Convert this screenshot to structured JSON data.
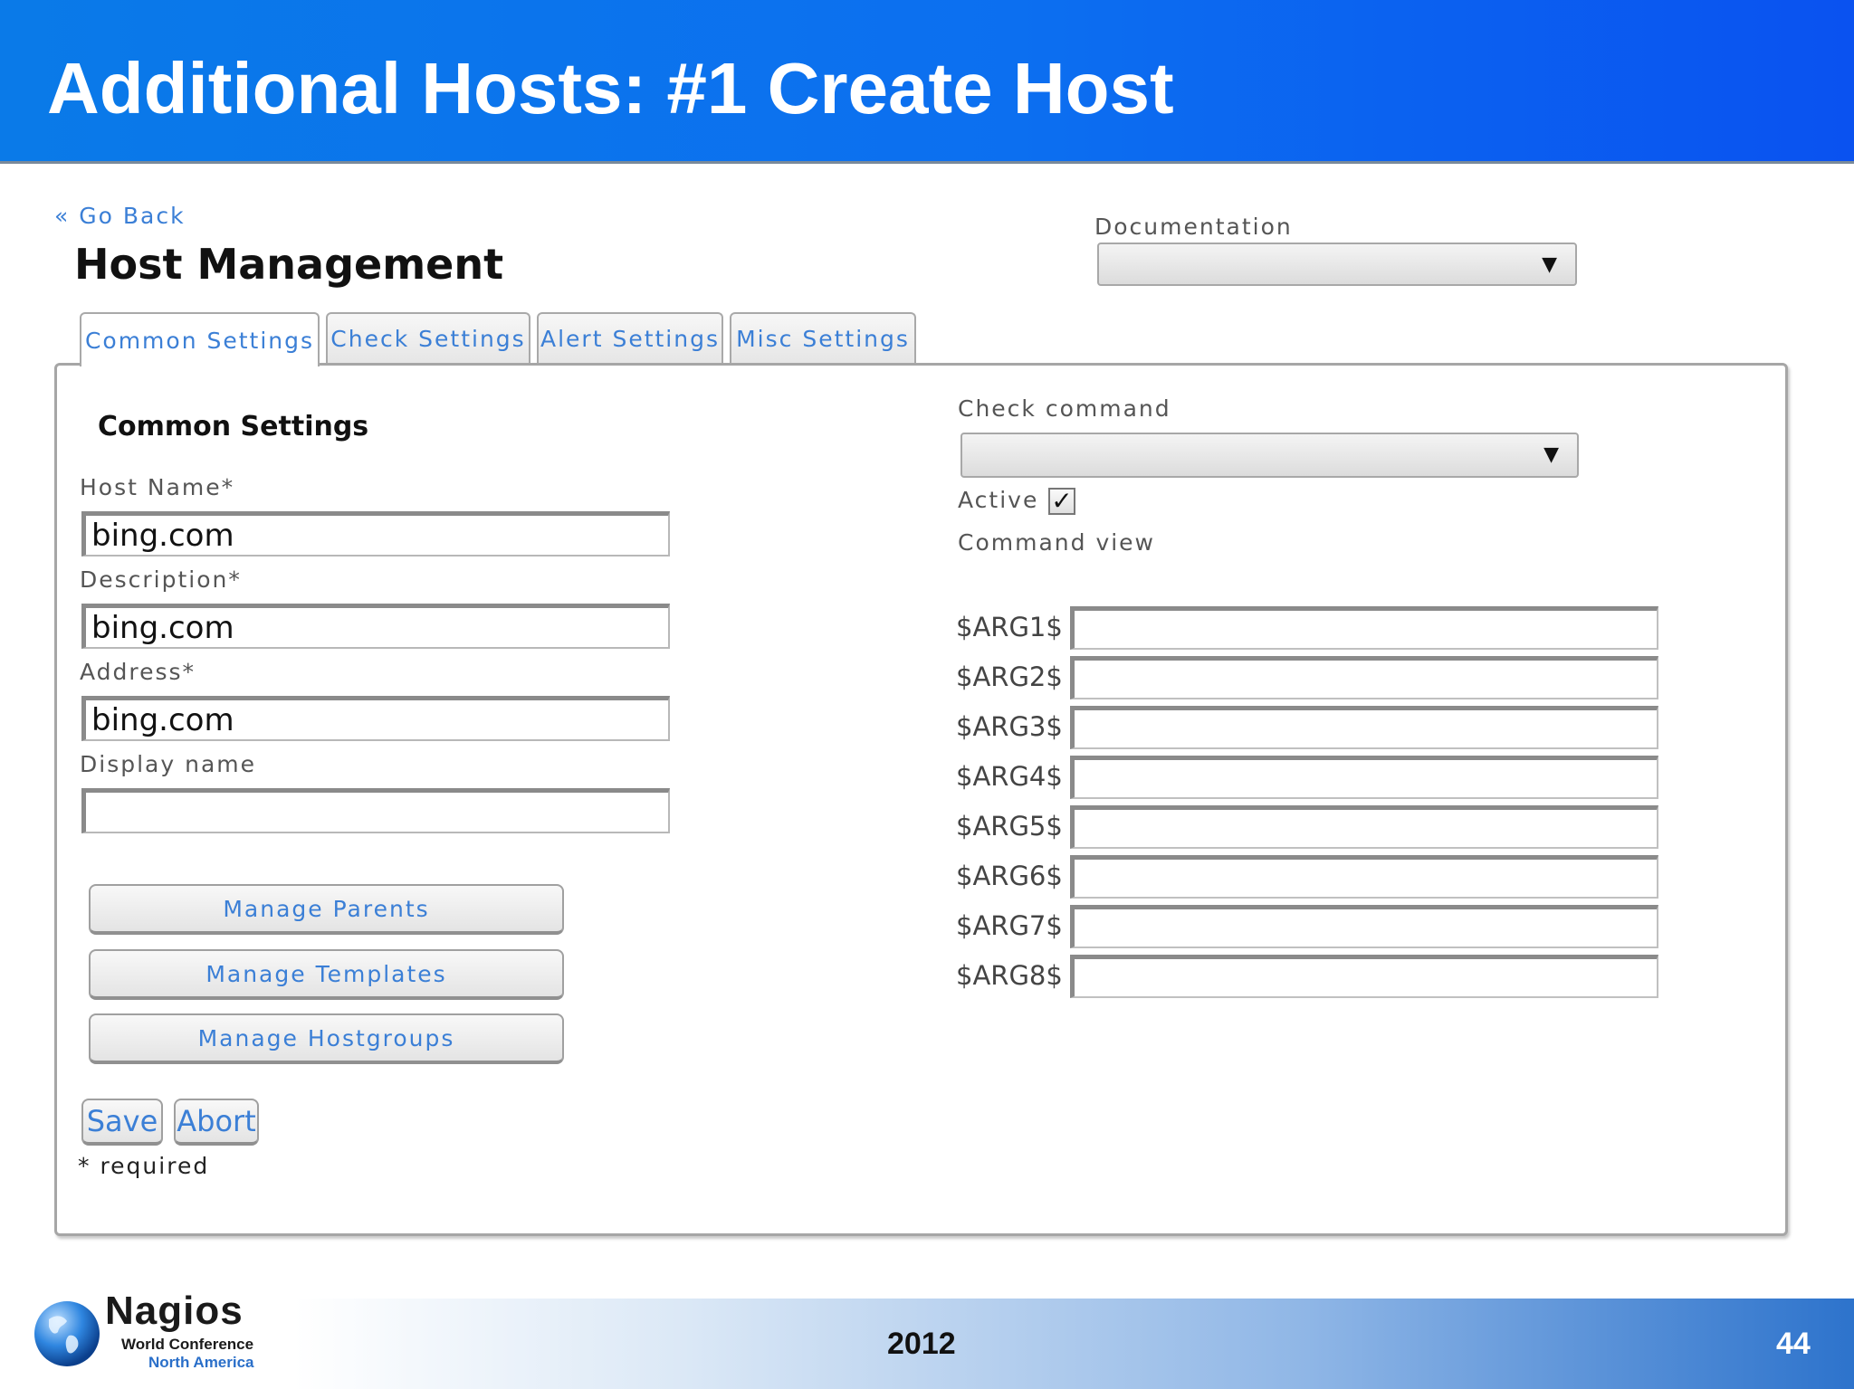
{
  "slide": {
    "title": "Additional Hosts: #1 Create Host"
  },
  "page": {
    "go_back": "« Go Back",
    "heading": "Host Management",
    "documentation": {
      "label": "Documentation",
      "value": ""
    }
  },
  "tabs": [
    {
      "label": "Common Settings",
      "active": true
    },
    {
      "label": "Check Settings",
      "active": false
    },
    {
      "label": "Alert Settings",
      "active": false
    },
    {
      "label": "Misc Settings",
      "active": false
    }
  ],
  "common": {
    "section_title": "Common Settings",
    "fields": [
      {
        "label": "Host Name*",
        "value": "bing.com"
      },
      {
        "label": "Description*",
        "value": "bing.com"
      },
      {
        "label": "Address*",
        "value": "bing.com"
      },
      {
        "label": "Display name",
        "value": ""
      }
    ],
    "buttons": [
      {
        "label": "Manage Parents"
      },
      {
        "label": "Manage Templates"
      },
      {
        "label": "Manage Hostgroups"
      }
    ],
    "save_label": "Save",
    "abort_label": "Abort",
    "required_note": "* required"
  },
  "check": {
    "command_label": "Check command",
    "command_value": "",
    "active_label": "Active",
    "active_checked": true,
    "command_view_label": "Command view",
    "args": [
      {
        "label": "$ARG1$",
        "value": ""
      },
      {
        "label": "$ARG2$",
        "value": ""
      },
      {
        "label": "$ARG3$",
        "value": ""
      },
      {
        "label": "$ARG4$",
        "value": ""
      },
      {
        "label": "$ARG5$",
        "value": ""
      },
      {
        "label": "$ARG6$",
        "value": ""
      },
      {
        "label": "$ARG7$",
        "value": ""
      },
      {
        "label": "$ARG8$",
        "value": ""
      }
    ]
  },
  "footer": {
    "logo_name": "Nagios",
    "logo_line1": "World Conference",
    "logo_line2": "North America",
    "year": "2012",
    "page_number": "44"
  },
  "icons": {
    "caret": "caret-down-icon",
    "check": "check-mark-icon",
    "globe": "globe-icon"
  },
  "colors": {
    "header_blue": "#0c6ff0",
    "link_blue": "#3b7fd6"
  }
}
